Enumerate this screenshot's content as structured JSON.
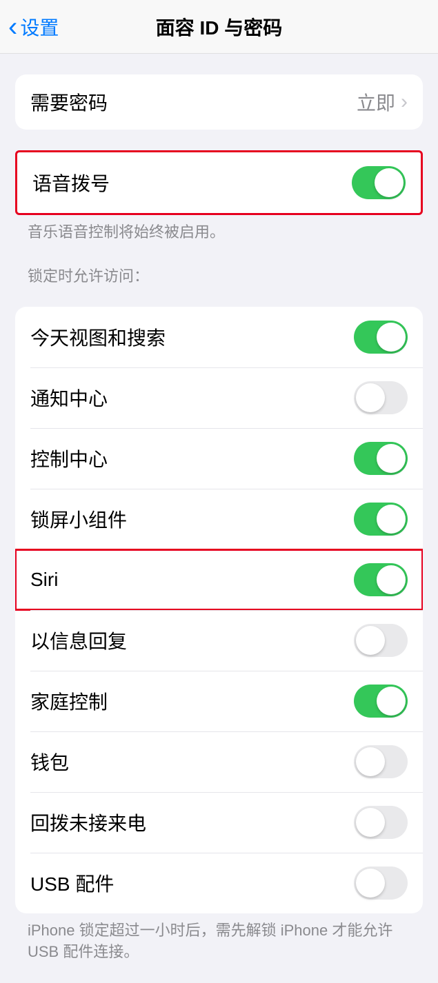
{
  "nav": {
    "back_label": "设置",
    "title": "面容 ID 与密码"
  },
  "require_passcode": {
    "label": "需要密码",
    "value": "立即"
  },
  "voice_dial": {
    "label": "语音拨号",
    "enabled": true,
    "footer": "音乐语音控制将始终被启用。"
  },
  "lock_access": {
    "header": "锁定时允许访问：",
    "items": [
      {
        "label": "今天视图和搜索",
        "enabled": true
      },
      {
        "label": "通知中心",
        "enabled": false
      },
      {
        "label": "控制中心",
        "enabled": true
      },
      {
        "label": "锁屏小组件",
        "enabled": true
      },
      {
        "label": "Siri",
        "enabled": true,
        "highlighted": true
      },
      {
        "label": "以信息回复",
        "enabled": false
      },
      {
        "label": "家庭控制",
        "enabled": true
      },
      {
        "label": "钱包",
        "enabled": false
      },
      {
        "label": "回拨未接来电",
        "enabled": false
      },
      {
        "label": "USB 配件",
        "enabled": false
      }
    ],
    "footer": "iPhone 锁定超过一小时后，需先解锁 iPhone 才能允许 USB 配件连接。"
  }
}
